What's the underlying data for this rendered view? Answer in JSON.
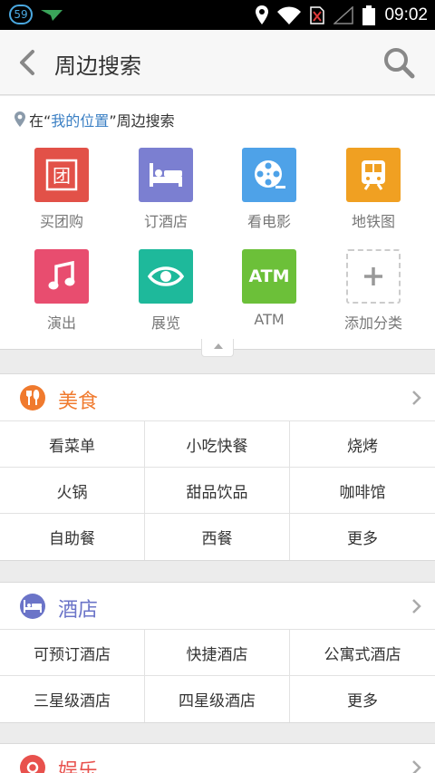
{
  "status_bar": {
    "badge": "59",
    "time": "09:02",
    "icons": [
      "notification-badge",
      "plane-icon",
      "location-icon",
      "wifi-icon",
      "sim-icon",
      "signal-icon",
      "battery-icon"
    ]
  },
  "header": {
    "title": "周边搜索",
    "back_icon": "chevron-left-icon",
    "search_icon": "search-icon"
  },
  "location": {
    "prefix": "在“",
    "place": "我的位置",
    "suffix": "”周边搜索"
  },
  "quick_categories": [
    {
      "label": "买团购",
      "icon": "groupbuy-icon",
      "icon_text": "团",
      "color": "#e25148"
    },
    {
      "label": "订酒店",
      "icon": "bed-icon",
      "color": "#7b7fd1"
    },
    {
      "label": "看电影",
      "icon": "film-reel-icon",
      "color": "#4ea2e8"
    },
    {
      "label": "地铁图",
      "icon": "subway-icon",
      "color": "#f0a022"
    },
    {
      "label": "演出",
      "icon": "music-note-icon",
      "color": "#e84d6f"
    },
    {
      "label": "展览",
      "icon": "eye-icon",
      "color": "#1eb99b"
    },
    {
      "label": "ATM",
      "icon": "atm-icon",
      "icon_text": "ATM",
      "color": "#6cc039"
    },
    {
      "label": "添加分类",
      "icon": "plus-icon",
      "color": "#ffffff"
    }
  ],
  "sections": [
    {
      "title": "美食",
      "icon": "fork-knife-icon",
      "color": "#f07a2e",
      "items": [
        "看菜单",
        "小吃快餐",
        "烧烤",
        "火锅",
        "甜品饮品",
        "咖啡馆",
        "自助餐",
        "西餐",
        "更多"
      ]
    },
    {
      "title": "酒店",
      "icon": "bed-icon",
      "color": "#6b74c8",
      "items": [
        "可预订酒店",
        "快捷酒店",
        "公寓式酒店",
        "三星级酒店",
        "四星级酒店",
        "更多"
      ]
    },
    {
      "title": "娱乐",
      "icon": "entertainment-icon",
      "color": "#e8514d",
      "items": []
    }
  ]
}
